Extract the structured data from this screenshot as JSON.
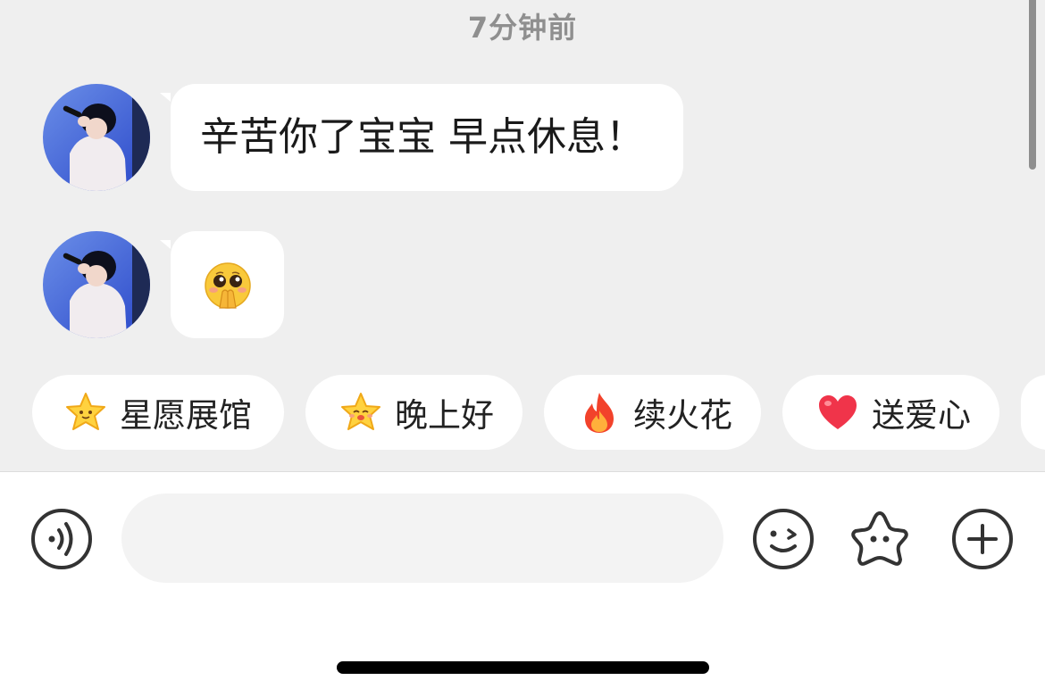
{
  "timestamp": "7分钟前",
  "messages": [
    {
      "sender": "avatar",
      "type": "text",
      "text": "辛苦你了宝宝 早点休息！"
    },
    {
      "sender": "avatar",
      "type": "sticker",
      "icon": "pleading-face-emoji"
    }
  ],
  "quick_replies": [
    {
      "label": "星愿展馆",
      "icon": "star-icon"
    },
    {
      "label": "晚上好",
      "icon": "smiling-star-icon"
    },
    {
      "label": "续火花",
      "icon": "fire-icon"
    },
    {
      "label": "送爱心",
      "icon": "heart-icon"
    }
  ],
  "input": {
    "placeholder": "",
    "value": ""
  },
  "toolbar": {
    "voice": "voice-icon",
    "emoji": "wink-emoji-icon",
    "sticker": "star-face-icon",
    "more": "plus-icon"
  },
  "colors": {
    "chat_background": "#efefef",
    "bubble": "#ffffff",
    "input_background": "#f3f3f3",
    "text": "#1a1a1a",
    "timestamp": "#8f8f8f"
  }
}
